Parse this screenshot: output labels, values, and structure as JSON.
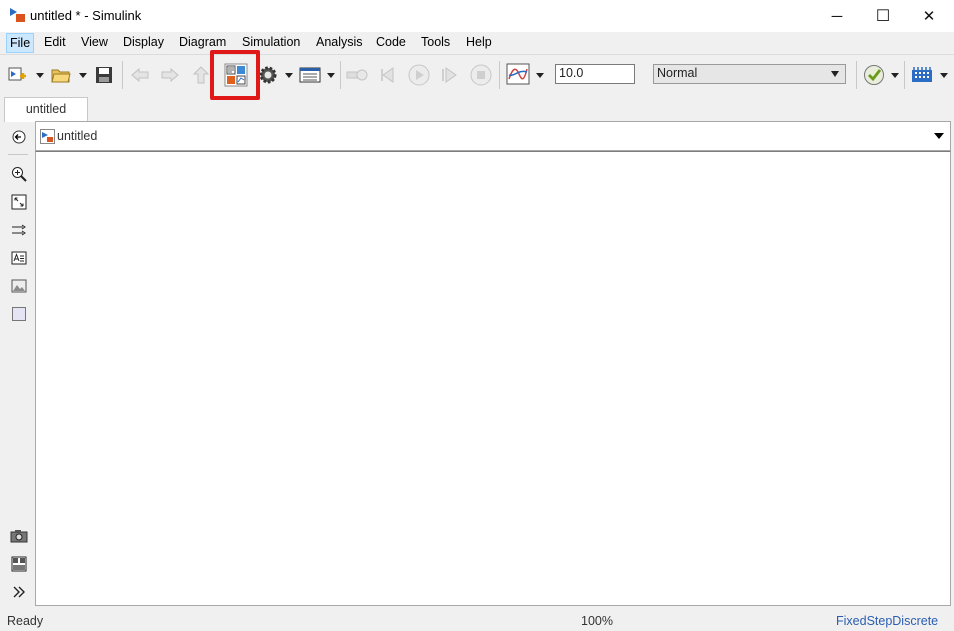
{
  "window": {
    "title": "untitled * - Simulink",
    "minimize_label": "─",
    "maximize_label": "☐",
    "close_label": "✕"
  },
  "menu": [
    {
      "label": "File"
    },
    {
      "label": "Edit"
    },
    {
      "label": "View"
    },
    {
      "label": "Display"
    },
    {
      "label": "Diagram"
    },
    {
      "label": "Simulation"
    },
    {
      "label": "Analysis"
    },
    {
      "label": "Code"
    },
    {
      "label": "Tools"
    },
    {
      "label": "Help"
    }
  ],
  "toolbar": {
    "stop_time": "10.0",
    "simulation_mode": "Normal",
    "highlighted_button": "library-browser-button"
  },
  "tabs": [
    {
      "label": "untitled"
    }
  ],
  "address": {
    "model_name": "untitled"
  },
  "status": {
    "ready": "Ready",
    "zoom": "100%",
    "solver": "FixedStepDiscrete"
  },
  "colors": {
    "highlight": "#e01818",
    "solver_text": "#2a5db0",
    "menu_active": "#cce8ff"
  }
}
